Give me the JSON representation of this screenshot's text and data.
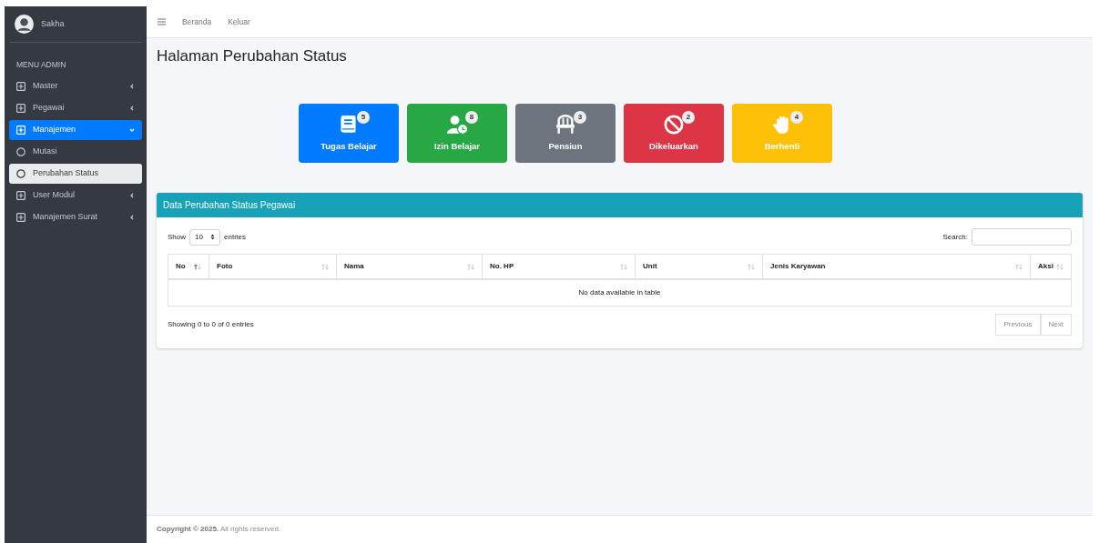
{
  "brand": {
    "name": "Sakha"
  },
  "topnav": [
    "Beranda",
    "Keluar"
  ],
  "sidebar": {
    "header": "MENU ADMIN",
    "items": [
      {
        "label": "Master",
        "kind": "group",
        "expanded": false,
        "selected": false
      },
      {
        "label": "Pegawai",
        "kind": "group",
        "expanded": false,
        "selected": false
      },
      {
        "label": "Manajemen",
        "kind": "group",
        "expanded": true,
        "selected": true,
        "children": [
          {
            "label": "Mutasi",
            "kind": "link",
            "selected": false
          },
          {
            "label": "Perubahan Status",
            "kind": "link",
            "selected": true
          }
        ]
      },
      {
        "label": "User Modul",
        "kind": "group",
        "expanded": false,
        "selected": false
      },
      {
        "label": "Manajemen Surat",
        "kind": "group",
        "expanded": false,
        "selected": false
      }
    ]
  },
  "page_title": "Halaman Perubahan Status",
  "stat_cards": [
    {
      "label": "Tugas Belajar",
      "count": "5",
      "kind": "book",
      "color": "#007bff"
    },
    {
      "label": "Izin Belajar",
      "count": "8",
      "kind": "user-clock",
      "color": "#28a745"
    },
    {
      "label": "Pensiun",
      "count": "3",
      "kind": "chair",
      "color": "#6c757d"
    },
    {
      "label": "Dikeluarkan",
      "count": "2",
      "kind": "ban",
      "color": "#dc3545"
    },
    {
      "label": "Berhenti",
      "count": "4",
      "kind": "hand",
      "color": "#ffc107"
    }
  ],
  "table_card": {
    "title": "Data Perubahan Status Pegawai",
    "length": {
      "before": "Show",
      "value": "10",
      "after": "entries"
    },
    "search_label": "Search:",
    "columns": [
      {
        "label": "No",
        "sorted": true
      },
      {
        "label": "Foto",
        "sorted": false
      },
      {
        "label": "Nama",
        "sorted": false
      },
      {
        "label": "No. HP",
        "sorted": false
      },
      {
        "label": "Unit",
        "sorted": false
      },
      {
        "label": "Jenis Karyawan",
        "sorted": false
      },
      {
        "label": "Aksi",
        "sorted": false
      }
    ],
    "empty_text": "No data available in table",
    "info": "Showing 0 to 0 of 0 entries",
    "pagination": [
      {
        "label": "Previous",
        "disabled": true
      },
      {
        "label": "Next",
        "disabled": true
      }
    ]
  },
  "footer": "**Copyright © 2025.** All rights reserved."
}
